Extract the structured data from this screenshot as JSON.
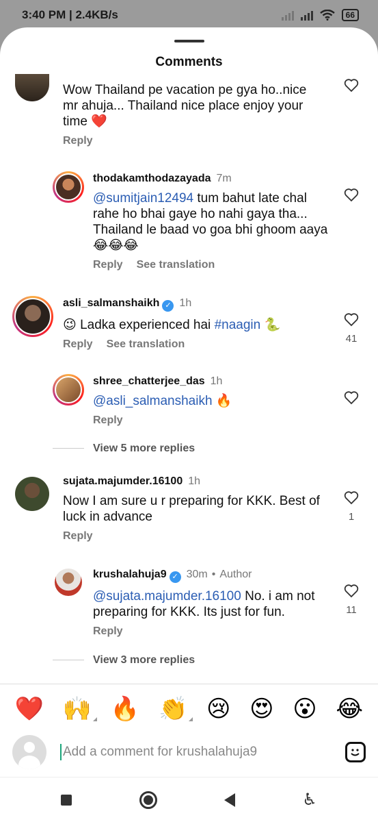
{
  "status_bar": {
    "time": "3:40 PM | 2.4KB/s",
    "battery": "66"
  },
  "sheet": {
    "title": "Comments"
  },
  "comments": [
    {
      "text": "Wow Thailand pe vacation pe gya ho..nice mr ahuja... Thailand nice place enjoy your time ❤️",
      "reply": "Reply"
    },
    {
      "username": "thodakamthodazayada",
      "time": "7m",
      "mention": "@sumitjain12494",
      "text": " tum bahut late chal rahe ho bhai gaye ho nahi gaya tha... Thailand le baad vo goa bhi ghoom aaya 😂😂😂",
      "reply": "Reply",
      "translate": "See translation"
    },
    {
      "username": "asli_salmanshaikh",
      "time": "1h",
      "prefix": "😉 Ladka experienced hai ",
      "tag": "#naagin",
      "suffix": " 🐍",
      "reply": "Reply",
      "translate": "See translation",
      "likes": "41"
    },
    {
      "username": "shree_chatterjee_das",
      "time": "1h",
      "mention": "@asli_salmanshaikh",
      "text": " 🔥",
      "reply": "Reply",
      "view_more": "View 5 more replies"
    },
    {
      "username": "sujata.majumder.16100",
      "time": "1h",
      "text": "Now I am sure u r preparing for KKK. Best of luck in advance",
      "reply": "Reply",
      "likes": "1"
    },
    {
      "username": "krushalahuja9",
      "time": "30m",
      "author": "Author",
      "mention": "@sujata.majumder.16100",
      "text": " No. i am not preparing for KKK. Its just for fun.",
      "reply": "Reply",
      "likes": "11",
      "view_more": "View 3 more replies"
    }
  ],
  "emoji_bar": [
    "❤️",
    "🙌",
    "🔥",
    "👏",
    "😢",
    "😍",
    "😮",
    "😂"
  ],
  "input": {
    "placeholder": "Add a comment for krushalahuja9"
  },
  "colors": {
    "mention": "#2b5db3",
    "verified": "#3897f0",
    "cursor": "#1aa47a"
  }
}
